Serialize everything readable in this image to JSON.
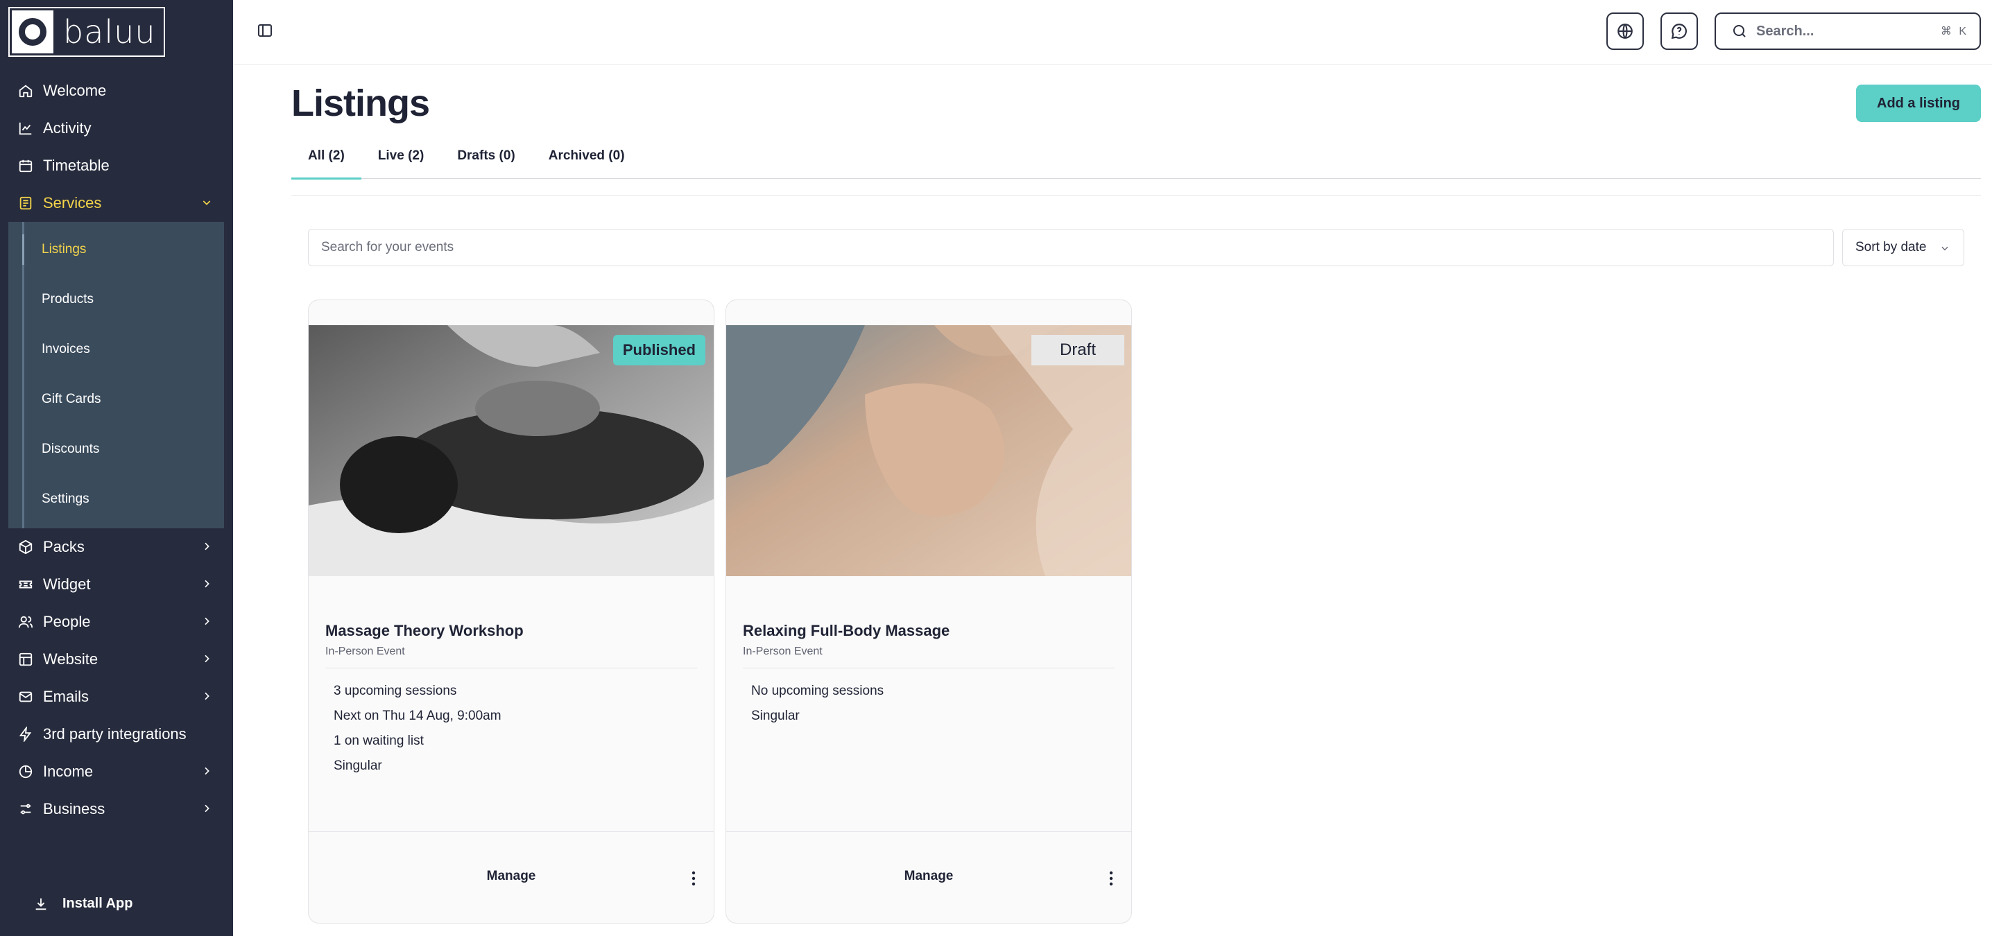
{
  "brand": {
    "logo_text": "baluu"
  },
  "sidebar": {
    "items": [
      {
        "label": "Welcome",
        "icon": "home-icon"
      },
      {
        "label": "Activity",
        "icon": "chart-line-icon"
      },
      {
        "label": "Timetable",
        "icon": "calendar-icon"
      },
      {
        "label": "Services",
        "icon": "file-list-icon",
        "expanded": true
      },
      {
        "label": "Packs",
        "icon": "package-icon"
      },
      {
        "label": "Widget",
        "icon": "ticket-icon"
      },
      {
        "label": "People",
        "icon": "users-icon"
      },
      {
        "label": "Website",
        "icon": "layout-icon"
      },
      {
        "label": "Emails",
        "icon": "mail-icon"
      },
      {
        "label": "3rd party integrations",
        "icon": "bolt-icon"
      },
      {
        "label": "Income",
        "icon": "pie-chart-icon"
      },
      {
        "label": "Business",
        "icon": "sliders-icon"
      }
    ],
    "services_sub": [
      "Listings",
      "Products",
      "Invoices",
      "Gift Cards",
      "Discounts",
      "Settings"
    ],
    "install_label": "Install App"
  },
  "topbar": {
    "search_placeholder": "Search...",
    "search_shortcut": "⌘ K"
  },
  "main": {
    "title": "Listings",
    "add_button": "Add a listing",
    "tabs": [
      "All (2)",
      "Live (2)",
      "Drafts (0)",
      "Archived (0)"
    ],
    "event_search_placeholder": "Search for your events",
    "sort_label": "Sort by date"
  },
  "cards": [
    {
      "status": "Published",
      "title": "Massage Theory Workshop",
      "type": "In-Person Event",
      "details": [
        "3 upcoming sessions",
        "Next on Thu 14 Aug, 9:00am",
        "1 on waiting list",
        "Singular"
      ],
      "manage": "Manage"
    },
    {
      "status": "Draft",
      "title": "Relaxing Full-Body Massage",
      "type": "In-Person Event",
      "details": [
        "No upcoming sessions",
        "Singular"
      ],
      "manage": "Manage"
    }
  ],
  "colors": {
    "sidebar_bg": "#262b3d",
    "sidebar_sub_bg": "#3a4b5c",
    "accent_yellow": "#f4d54a",
    "accent_teal": "#5ccfc7"
  }
}
